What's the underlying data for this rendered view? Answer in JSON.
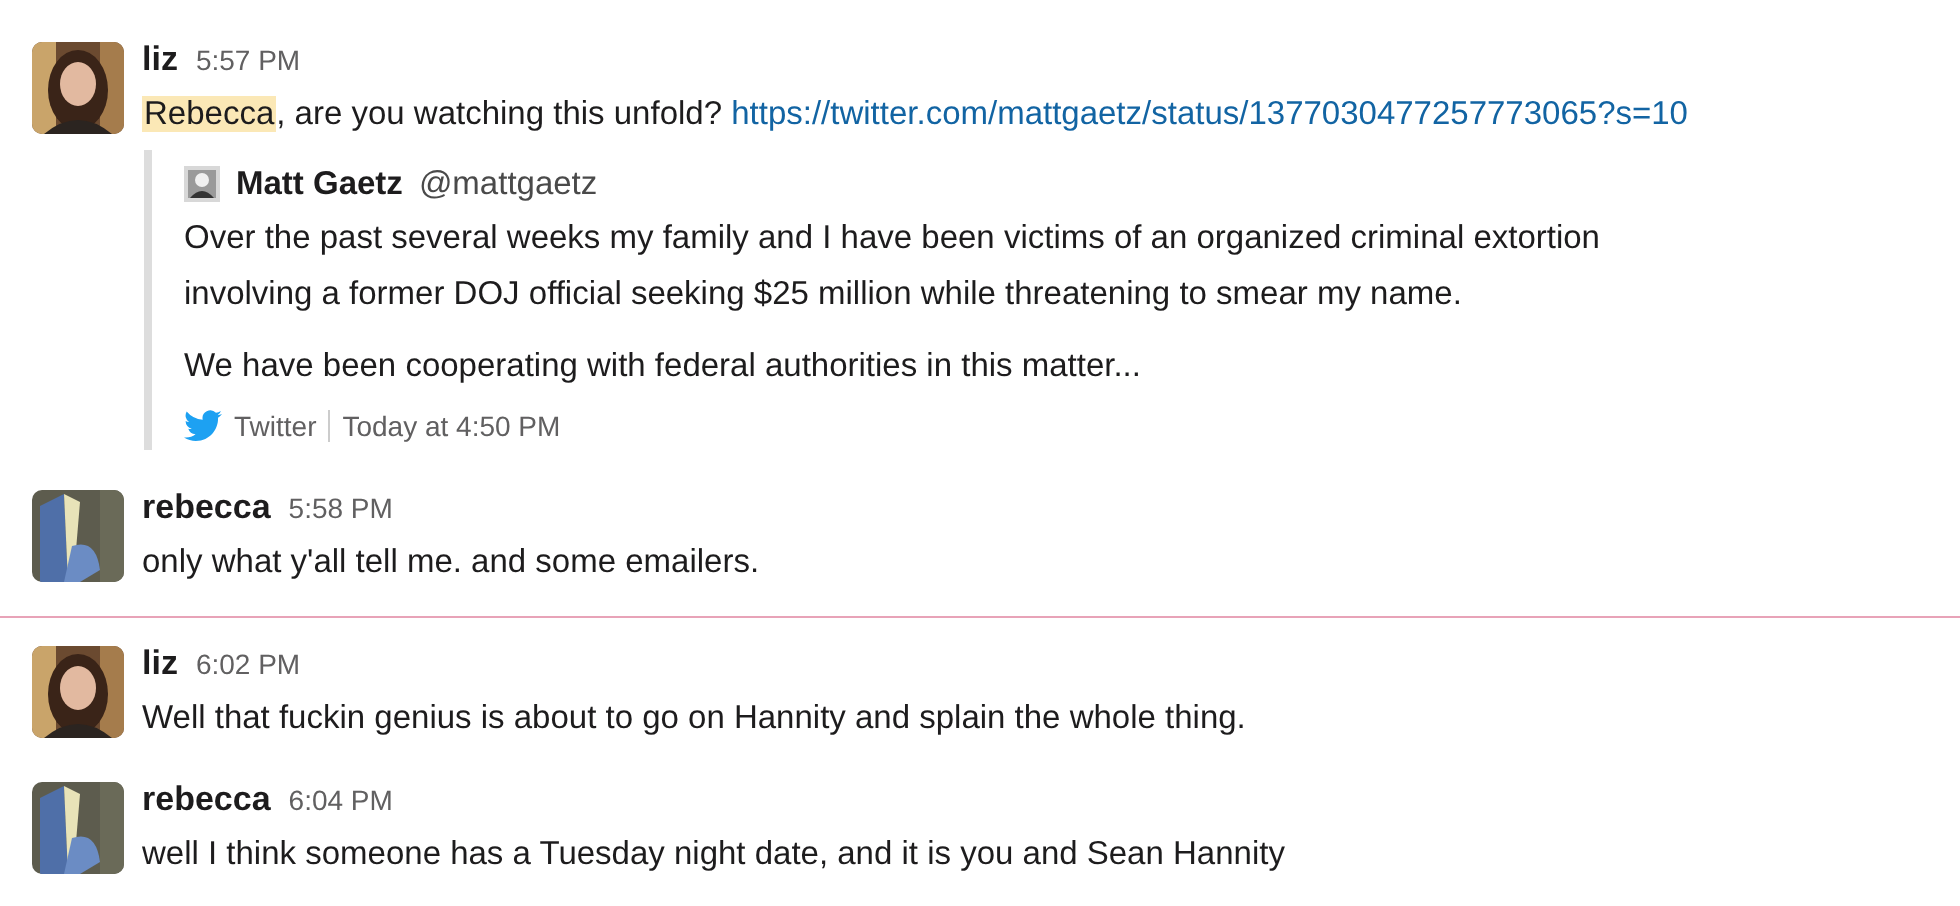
{
  "messages": [
    {
      "author": "liz",
      "time": "5:57 PM",
      "unread_divider_before": false,
      "parts": [
        {
          "kind": "mention",
          "text": "Rebecca"
        },
        {
          "kind": "text",
          "text": ", are you watching this unfold? "
        },
        {
          "kind": "link",
          "text": "https://twitter.com/mattgaetz/status/1377030477257773065?s=10"
        }
      ],
      "attachment": {
        "author_name": "Matt Gaetz",
        "handle": "@mattgaetz",
        "paragraphs": [
          "Over the past several weeks my family and I have been victims of an organized criminal extortion involving a former DOJ official seeking $25 million while threatening to smear my name.",
          "We have been cooperating with federal authorities in this matter..."
        ],
        "service": "Twitter",
        "time": "Today at 4:50 PM"
      }
    },
    {
      "author": "rebecca",
      "time": "5:58 PM",
      "unread_divider_before": false,
      "parts": [
        {
          "kind": "text",
          "text": "only what y'all tell me. and some emailers."
        }
      ]
    },
    {
      "author": "liz",
      "time": "6:02 PM",
      "unread_divider_before": true,
      "parts": [
        {
          "kind": "text",
          "text": "Well that fuckin genius is about to go on Hannity and splain the whole thing."
        }
      ]
    },
    {
      "author": "rebecca",
      "time": "6:04 PM",
      "unread_divider_before": false,
      "parts": [
        {
          "kind": "text",
          "text": "well I think someone has a Tuesday night date, and it is you and Sean Hannity"
        }
      ]
    }
  ]
}
